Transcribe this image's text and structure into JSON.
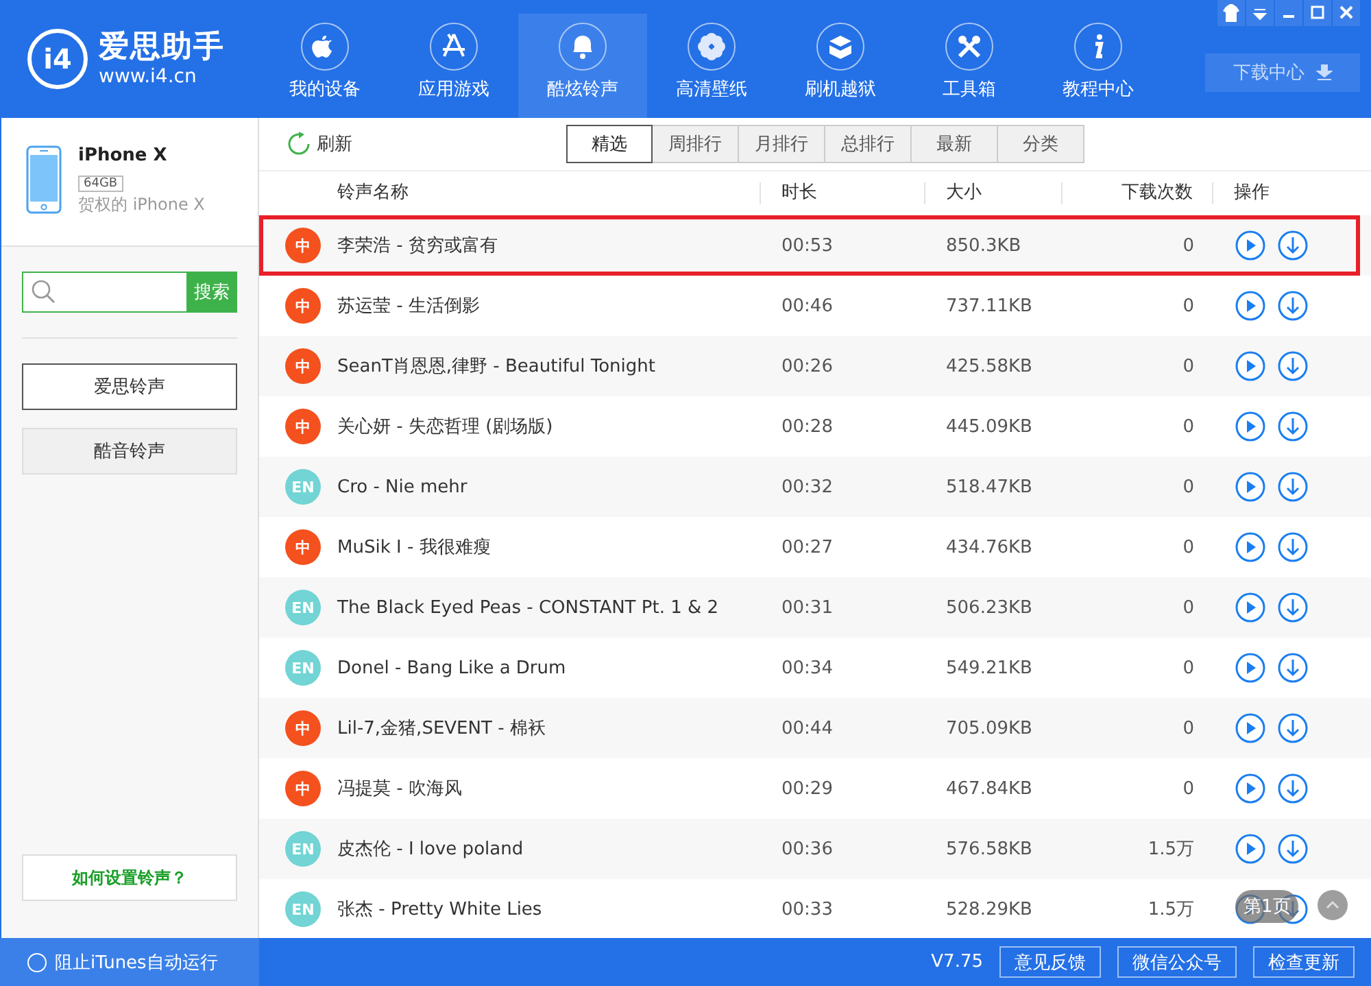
{
  "app": {
    "logo_mark": "i4",
    "name": "爱思助手",
    "url": "www.i4.cn"
  },
  "nav": [
    {
      "label": "我的设备",
      "selected": false
    },
    {
      "label": "应用游戏",
      "selected": false
    },
    {
      "label": "酷炫铃声",
      "selected": true
    },
    {
      "label": "高清壁纸",
      "selected": false
    },
    {
      "label": "刷机越狱",
      "selected": false
    },
    {
      "label": "工具箱",
      "selected": false
    },
    {
      "label": "教程中心",
      "selected": false
    }
  ],
  "download_center": {
    "label": "下载中心"
  },
  "device": {
    "name": "iPhone X",
    "capacity": "64GB",
    "owner": "贺权的 iPhone X"
  },
  "search": {
    "button": "搜索"
  },
  "sources": [
    {
      "label": "爱思铃声",
      "selected": true
    },
    {
      "label": "酷音铃声",
      "selected": false
    }
  ],
  "help_link": "如何设置铃声？",
  "toolbar": {
    "refresh": "刷新"
  },
  "tabs": [
    {
      "label": "精选",
      "selected": true
    },
    {
      "label": "周排行",
      "selected": false
    },
    {
      "label": "月排行",
      "selected": false
    },
    {
      "label": "总排行",
      "selected": false
    },
    {
      "label": "最新",
      "selected": false
    },
    {
      "label": "分类",
      "selected": false
    }
  ],
  "table": {
    "columns": [
      "铃声名称",
      "时长",
      "大小",
      "下载次数",
      "操作"
    ],
    "rows": [
      {
        "badge": "中",
        "color": "#f4511e",
        "name": "李荣浩 - 贫穷或富有",
        "duration": "00:53",
        "size": "850.3KB",
        "downloads": "0",
        "highlighted": true
      },
      {
        "badge": "中",
        "color": "#f4511e",
        "name": "苏运莹 - 生活倒影",
        "duration": "00:46",
        "size": "737.11KB",
        "downloads": "0",
        "highlighted": false
      },
      {
        "badge": "中",
        "color": "#f4511e",
        "name": "SeanT肖恩恩,律野 - Beautiful Tonight",
        "duration": "00:26",
        "size": "425.58KB",
        "downloads": "0",
        "highlighted": false
      },
      {
        "badge": "中",
        "color": "#f4511e",
        "name": "关心妍 - 失恋哲理 (剧场版)",
        "duration": "00:28",
        "size": "445.09KB",
        "downloads": "0",
        "highlighted": false
      },
      {
        "badge": "EN",
        "color": "#72d4d4",
        "name": "Cro - Nie mehr",
        "duration": "00:32",
        "size": "518.47KB",
        "downloads": "0",
        "highlighted": false
      },
      {
        "badge": "中",
        "color": "#f4511e",
        "name": "MuSik I - 我很难瘦",
        "duration": "00:27",
        "size": "434.76KB",
        "downloads": "0",
        "highlighted": false
      },
      {
        "badge": "EN",
        "color": "#72d4d4",
        "name": "The Black Eyed Peas - CONSTANT Pt. 1 & 2",
        "duration": "00:31",
        "size": "506.23KB",
        "downloads": "0",
        "highlighted": false
      },
      {
        "badge": "EN",
        "color": "#72d4d4",
        "name": "Donel - Bang Like a Drum",
        "duration": "00:34",
        "size": "549.21KB",
        "downloads": "0",
        "highlighted": false
      },
      {
        "badge": "中",
        "color": "#f4511e",
        "name": "Lil-7,金猪,SEVENT - 棉袄",
        "duration": "00:44",
        "size": "705.09KB",
        "downloads": "0",
        "highlighted": false
      },
      {
        "badge": "中",
        "color": "#f4511e",
        "name": "冯提莫 - 吹海风",
        "duration": "00:29",
        "size": "467.84KB",
        "downloads": "0",
        "highlighted": false
      },
      {
        "badge": "EN",
        "color": "#72d4d4",
        "name": "皮杰伦 - I love poland",
        "duration": "00:36",
        "size": "576.58KB",
        "downloads": "1.5万",
        "highlighted": false
      },
      {
        "badge": "EN",
        "color": "#72d4d4",
        "name": "张杰 - Pretty White Lies",
        "duration": "00:33",
        "size": "528.29KB",
        "downloads": "1.5万",
        "highlighted": false
      }
    ]
  },
  "page_indicator": "第1页",
  "status_bar": {
    "itunes_block": {
      "label": "阻止iTunes自动运行",
      "checked": false
    },
    "version": "V7.75",
    "buttons": [
      "意见反馈",
      "微信公众号",
      "检查更新"
    ]
  }
}
